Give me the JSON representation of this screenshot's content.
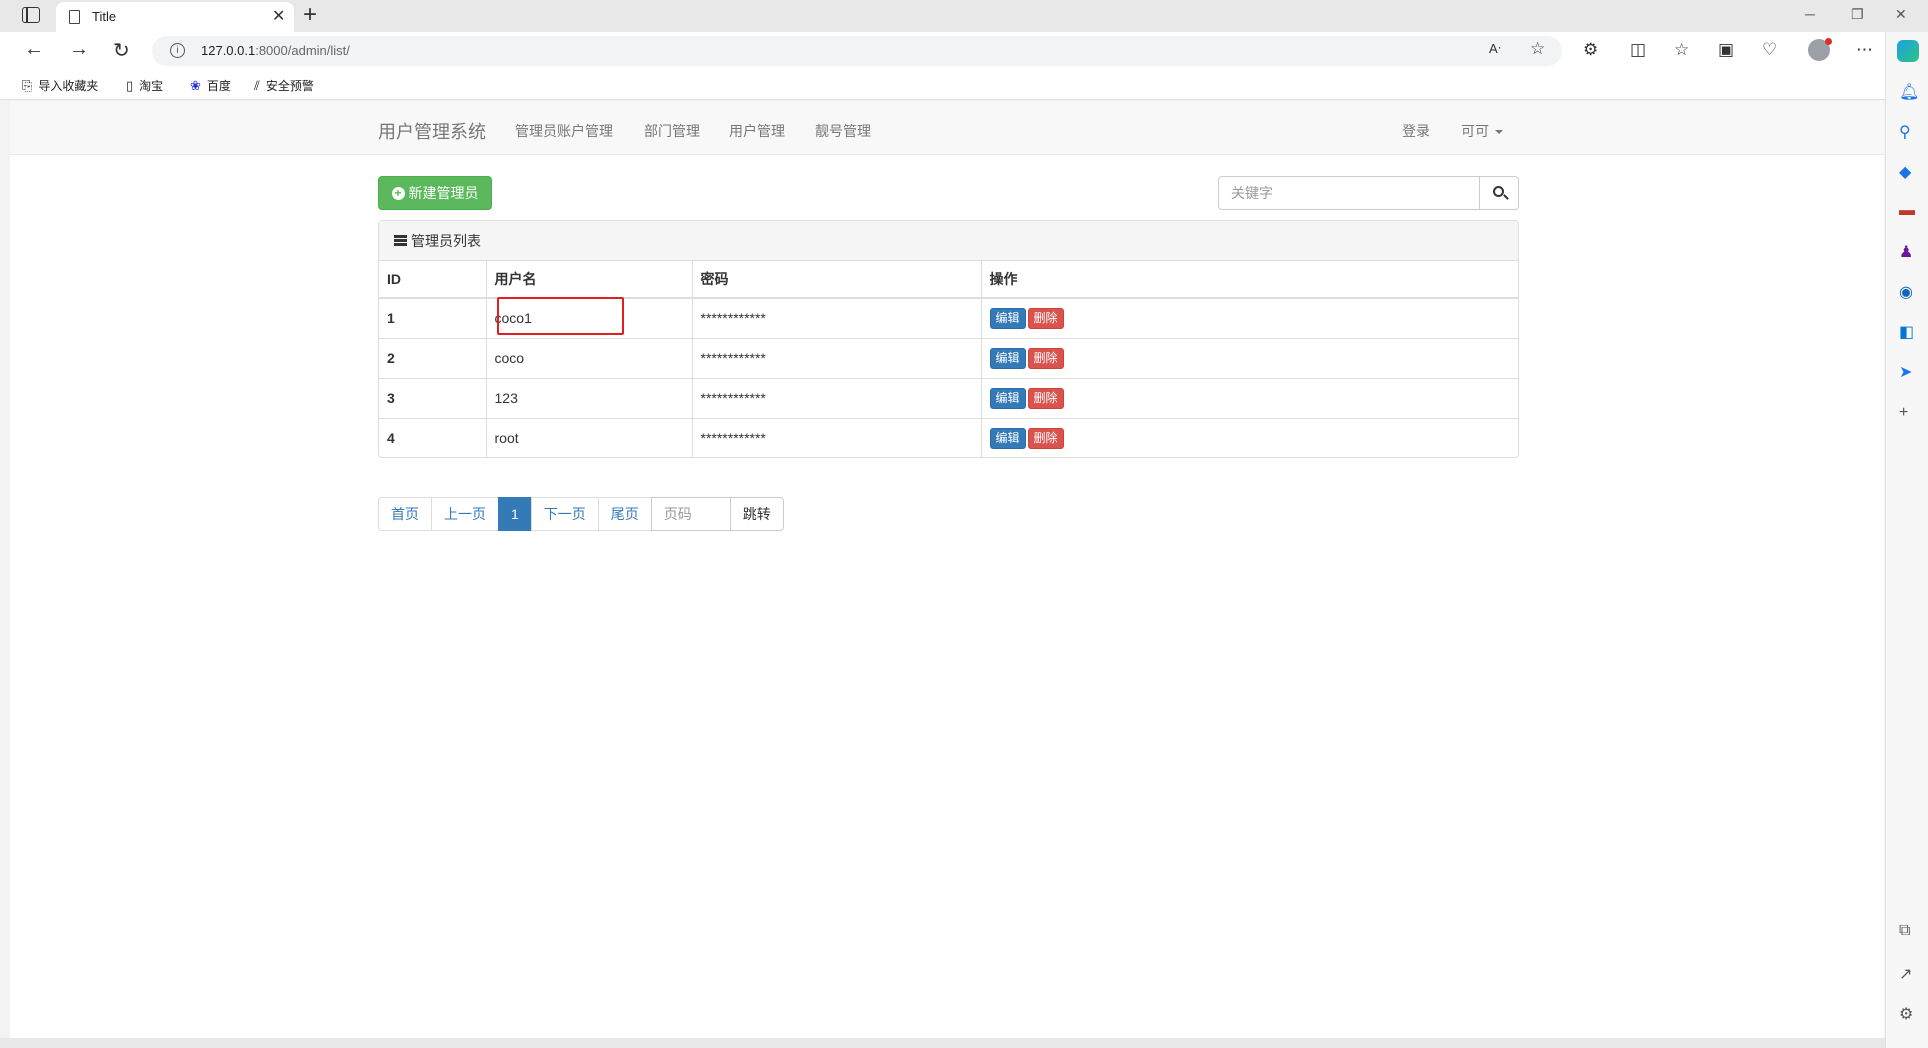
{
  "browser": {
    "tab_title": "Title",
    "url_host": "127.0.0.1",
    "url_rest": ":8000/admin/list/",
    "bookmarks": [
      {
        "label": "导入收藏夹",
        "icon": "import-favorites-icon"
      },
      {
        "label": "淘宝",
        "icon": "page-icon"
      },
      {
        "label": "百度",
        "icon": "baidu-paw-icon"
      },
      {
        "label": "安全预警",
        "icon": "security-alert-icon"
      }
    ]
  },
  "navbar": {
    "brand": "用户管理系统",
    "links": [
      "管理员账户管理",
      "部门管理",
      "用户管理",
      "靓号管理"
    ],
    "login": "登录",
    "user": "可可"
  },
  "toolbar": {
    "add_label": "新建管理员",
    "search_placeholder": "关键字"
  },
  "panel": {
    "title": "管理员列表",
    "columns": [
      "ID",
      "用户名",
      "密码",
      "操作"
    ],
    "rows": [
      {
        "id": "1",
        "username": "coco1",
        "password": "************"
      },
      {
        "id": "2",
        "username": "coco",
        "password": "************"
      },
      {
        "id": "3",
        "username": "123",
        "password": "************"
      },
      {
        "id": "4",
        "username": "root",
        "password": "************"
      }
    ],
    "edit_label": "编辑",
    "delete_label": "删除"
  },
  "pagination": {
    "first": "首页",
    "prev": "上一页",
    "current": "1",
    "next": "下一页",
    "last": "尾页",
    "page_placeholder": "页码",
    "jump": "跳转"
  },
  "colors": {
    "primary": "#337ab7",
    "success": "#5cb85c",
    "danger": "#d9534f",
    "highlight": "#e02020"
  }
}
